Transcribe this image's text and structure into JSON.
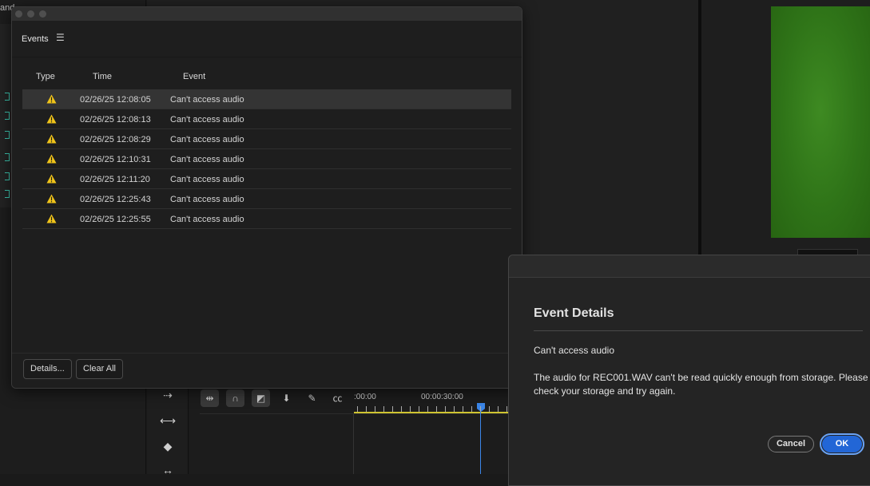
{
  "background": {
    "top_left_text": "and",
    "timeline": {
      "ruler_start": ":00:00",
      "ruler_mark": "00:00:30:00"
    }
  },
  "events_panel": {
    "title": "Events",
    "columns": {
      "type": "Type",
      "time": "Time",
      "event": "Event"
    },
    "rows": [
      {
        "type_icon": "warning-icon",
        "time": "02/26/25 12:08:05",
        "event": "Can't access audio",
        "selected": true
      },
      {
        "type_icon": "warning-icon",
        "time": "02/26/25 12:08:13",
        "event": "Can't access audio",
        "selected": false
      },
      {
        "type_icon": "warning-icon",
        "time": "02/26/25 12:08:29",
        "event": "Can't access audio",
        "selected": false
      },
      {
        "type_icon": "warning-icon",
        "time": "02/26/25 12:10:31",
        "event": "Can't access audio",
        "selected": false
      },
      {
        "type_icon": "warning-icon",
        "time": "02/26/25 12:11:20",
        "event": "Can't access audio",
        "selected": false
      },
      {
        "type_icon": "warning-icon",
        "time": "02/26/25 12:25:43",
        "event": "Can't access audio",
        "selected": false
      },
      {
        "type_icon": "warning-icon",
        "time": "02/26/25 12:25:55",
        "event": "Can't access audio",
        "selected": false
      }
    ],
    "buttons": {
      "details": "Details...",
      "clear_all": "Clear All"
    }
  },
  "event_details": {
    "title": "Event Details",
    "heading": "Can't access audio",
    "message": "The audio for REC001.WAV can't be read quickly enough from storage. Please check your storage and try again.",
    "buttons": {
      "cancel": "Cancel",
      "ok": "OK"
    }
  },
  "colors": {
    "warning": "#f0c419",
    "ok_button": "#2266d6",
    "playhead": "#3b86e8",
    "work_area": "#cfc431",
    "clip_green": "#2f7418"
  }
}
